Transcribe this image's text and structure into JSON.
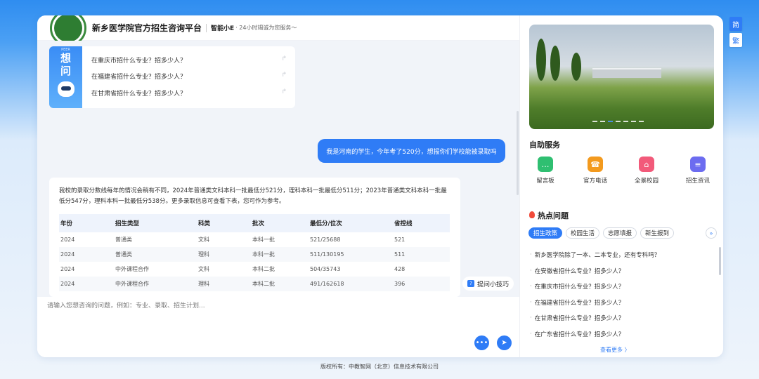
{
  "lang": {
    "simplified": "简",
    "traditional": "繁"
  },
  "header": {
    "title": "新乡医学院官方招生咨询平台",
    "bot_name": "智能小E",
    "bot_tagline": "· 24小时竭诚为您服务～"
  },
  "ask_card": {
    "side_small": "PEER",
    "side_big_1": "想",
    "side_big_2": "问",
    "items": [
      "在重庆市招什么专业？招多少人？",
      "在福建省招什么专业？招多少人？",
      "在甘肃省招什么专业？招多少人？"
    ]
  },
  "user_message": "我是河南的学生，今年考了520分，想报你们学校能被录取吗",
  "answer": {
    "text": "我校的录取分数线每年的情况会稍有不同，2024年普通类文科本科一批最低分521分，理科本科一批最低分511分；2023年普通类文科本科一批最低分547分，理科本科一批最低分538分。更多录取信息可查看下表，您可作为参考。",
    "columns": [
      "年份",
      "招生类型",
      "科类",
      "批次",
      "最低分/位次",
      "省控线"
    ],
    "rows": [
      [
        "2024",
        "普通类",
        "文科",
        "本科一批",
        "521/25688",
        "521"
      ],
      [
        "2024",
        "普通类",
        "理科",
        "本科一批",
        "511/130195",
        "511"
      ],
      [
        "2024",
        "中外课程合作",
        "文科",
        "本科二批",
        "504/35743",
        "428"
      ],
      [
        "2024",
        "中外课程合作",
        "理科",
        "本科二批",
        "491/162618",
        "396"
      ]
    ]
  },
  "tips_label": "提问小技巧",
  "input_placeholder": "请输入您想咨询的问题，例如：专业、录取、招生计划...",
  "services": {
    "title": "自助服务",
    "items": [
      {
        "label": "留言板",
        "icon": "message-board-icon",
        "color": "#2fbf71"
      },
      {
        "label": "官方电话",
        "icon": "phone-icon",
        "color": "#f39a1e"
      },
      {
        "label": "全景校园",
        "icon": "campus-icon",
        "color": "#f25a7a"
      },
      {
        "label": "招生资讯",
        "icon": "news-icon",
        "color": "#6c6cf0"
      }
    ]
  },
  "hot": {
    "title": "热点问题",
    "tabs": [
      "招生政策",
      "校园生活",
      "志愿填报",
      "新生报到"
    ],
    "items": [
      "新乡医学院除了一本、二本专业，还有专科吗？",
      "在安徽省招什么专业？招多少人？",
      "在重庆市招什么专业？招多少人？",
      "在福建省招什么专业？招多少人？",
      "在甘肃省招什么专业？招多少人？",
      "在广东省招什么专业？招多少人？"
    ],
    "more": "查看更多 〉"
  },
  "footer": "版权所有：中教智网（北京）信息技术有限公司"
}
